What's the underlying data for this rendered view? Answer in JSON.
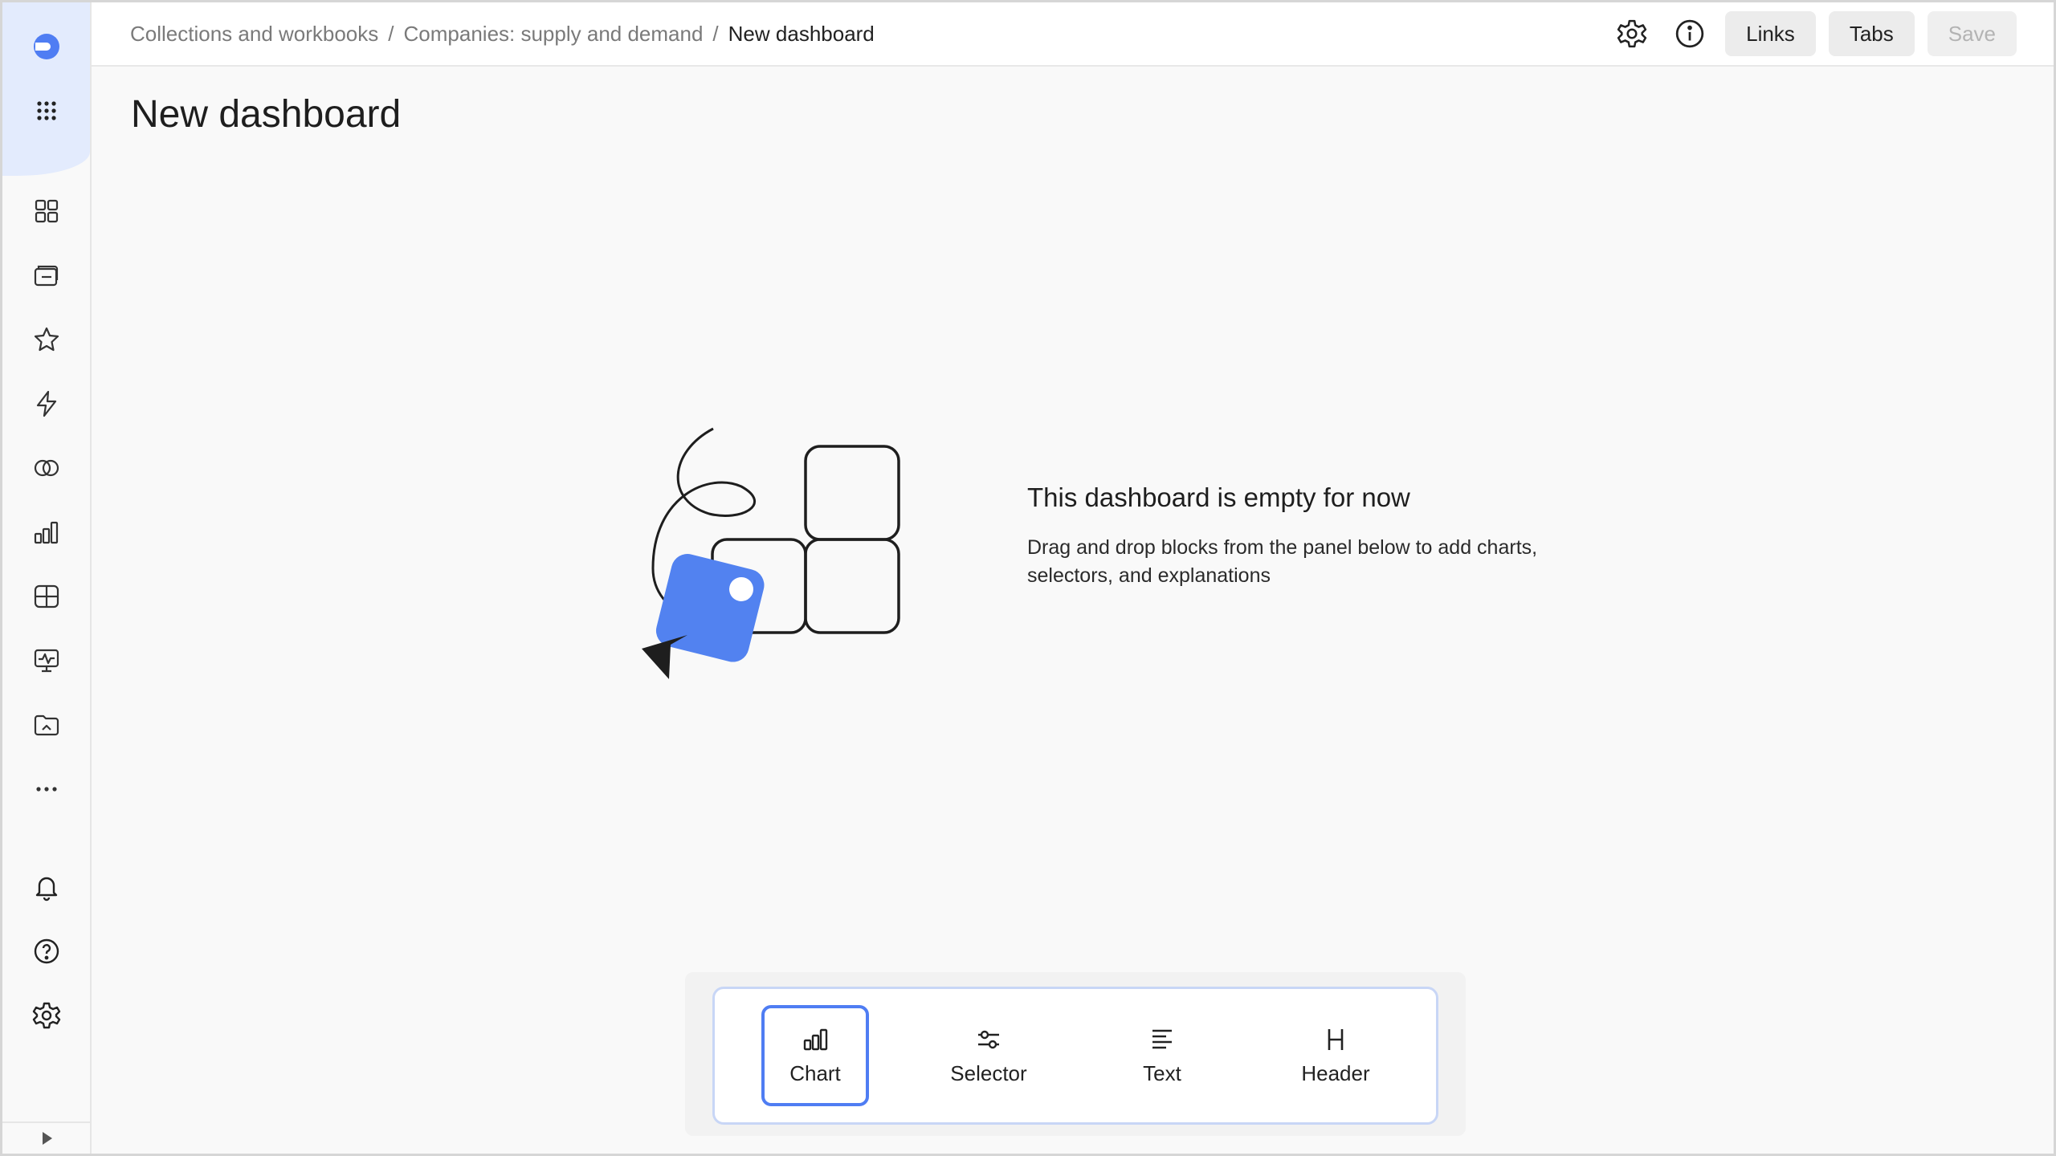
{
  "breadcrumbs": [
    {
      "label": "Collections and workbooks"
    },
    {
      "label": "Companies: supply and demand"
    },
    {
      "label": "New dashboard"
    }
  ],
  "breadcrumb_separator": "/",
  "header": {
    "links_label": "Links",
    "tabs_label": "Tabs",
    "save_label": "Save"
  },
  "page_title": "New dashboard",
  "empty_state": {
    "title": "This dashboard is empty for now",
    "description": "Drag and drop blocks from the panel below to add charts, selectors, and explanations"
  },
  "panel": {
    "items": [
      {
        "label": "Chart",
        "icon": "bar-chart-icon",
        "selected": true
      },
      {
        "label": "Selector",
        "icon": "sliders-icon",
        "selected": false
      },
      {
        "label": "Text",
        "icon": "text-lines-icon",
        "selected": false
      },
      {
        "label": "Header",
        "icon": "heading-icon",
        "selected": false
      }
    ]
  },
  "sidebar": {
    "items": [
      {
        "icon": "logo-icon"
      },
      {
        "icon": "apps-grid-icon"
      },
      {
        "icon": "dashboards-icon"
      },
      {
        "icon": "collections-icon"
      },
      {
        "icon": "favorites-star-icon"
      },
      {
        "icon": "connections-bolt-icon"
      },
      {
        "icon": "datasets-icon"
      },
      {
        "icon": "charts-icon"
      },
      {
        "icon": "reports-icon"
      },
      {
        "icon": "monitoring-icon"
      },
      {
        "icon": "folder-icon"
      },
      {
        "icon": "more-icon"
      },
      {
        "icon": "notifications-bell-icon"
      },
      {
        "icon": "help-icon"
      },
      {
        "icon": "settings-gear-icon"
      },
      {
        "icon": "collapse-arrow-icon"
      }
    ]
  },
  "colors": {
    "accent": "#4f7df3",
    "sidebar_highlight": "#e3ebfd",
    "background": "#f9f9f9"
  }
}
